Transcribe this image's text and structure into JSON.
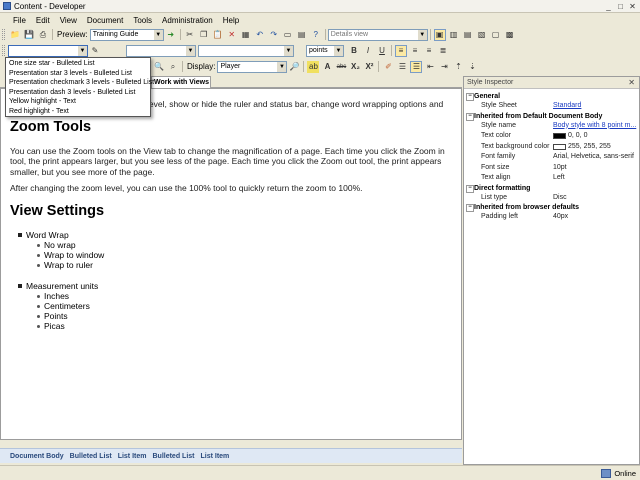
{
  "window": {
    "title": "Content - Developer"
  },
  "menu": [
    "File",
    "Edit",
    "View",
    "Document",
    "Tools",
    "Administration",
    "Help"
  ],
  "toolbar1": {
    "preview_label": "Preview:",
    "preview_value": "Training Guide",
    "view_value": "Details view"
  },
  "toolbar2": {
    "style_value": "",
    "font_value": "",
    "size_value": "",
    "units_value": "points",
    "bold": "B",
    "italic": "I",
    "underline": "U"
  },
  "toolbar3": {
    "display_label": "Display:",
    "display_value": "Player",
    "strike": "abc",
    "subscript": "X₂",
    "superscript": "X²"
  },
  "style_dropdown": [
    "One size star - Bulleted List",
    "Presentation star 3 levels - Bulleted List",
    "Presentation checkmark 3 levels - Bulleted List",
    "Presentation dash 3 levels - Bulleted List",
    "Yellow highlight - Text",
    "Red highlight - Text"
  ],
  "tab": {
    "label": "Work with Views"
  },
  "document": {
    "intro_fragment": "level, show or hide the ruler and status bar, change word wrapping options and",
    "h_zoom": "Zoom Tools",
    "p_zoom1": "You can use the Zoom tools on the View tab to change the magnification of a page. Each time you click the Zoom in tool, the print appears larger, but you see less of the page. Each time you click the Zoom out tool, the print appears smaller, but you see more of the page.",
    "p_zoom2": "After changing the zoom level, you can use the 100% tool to quickly return the zoom to 100%.",
    "h_view": "View Settings",
    "word_wrap": "Word Wrap",
    "wrap_items": [
      "No wrap",
      "Wrap to window",
      "Wrap to ruler"
    ],
    "units": "Measurement units",
    "unit_items": [
      "Inches",
      "Centimeters",
      "Points",
      "Picas"
    ]
  },
  "breadcrumb": [
    "Document Body",
    "Bulleted List",
    "List Item",
    "Bulleted List",
    "List Item"
  ],
  "inspector": {
    "title": "Style Inspector",
    "sections": [
      {
        "name": "General",
        "rows": [
          {
            "k": "Style Sheet",
            "v": "Standard",
            "link": true
          }
        ]
      },
      {
        "name": "Inherited from Default Document Body",
        "rows": [
          {
            "k": "Style name",
            "v": "Body style with 8 point m...",
            "link": true
          },
          {
            "k": "Text color",
            "v": "0, 0, 0",
            "swatch": "#000000"
          },
          {
            "k": "Text background color",
            "v": "255, 255, 255",
            "swatch": "#ffffff"
          },
          {
            "k": "Font family",
            "v": "Arial, Helvetica, sans-serif"
          },
          {
            "k": "Font size",
            "v": "10pt"
          },
          {
            "k": "Text align",
            "v": "Left"
          }
        ]
      },
      {
        "name": "Direct formatting",
        "rows": [
          {
            "k": "List type",
            "v": "Disc"
          }
        ]
      },
      {
        "name": "Inherited from browser defaults",
        "rows": [
          {
            "k": "Padding left",
            "v": "40px"
          }
        ]
      }
    ]
  },
  "status": {
    "text": "Online"
  }
}
